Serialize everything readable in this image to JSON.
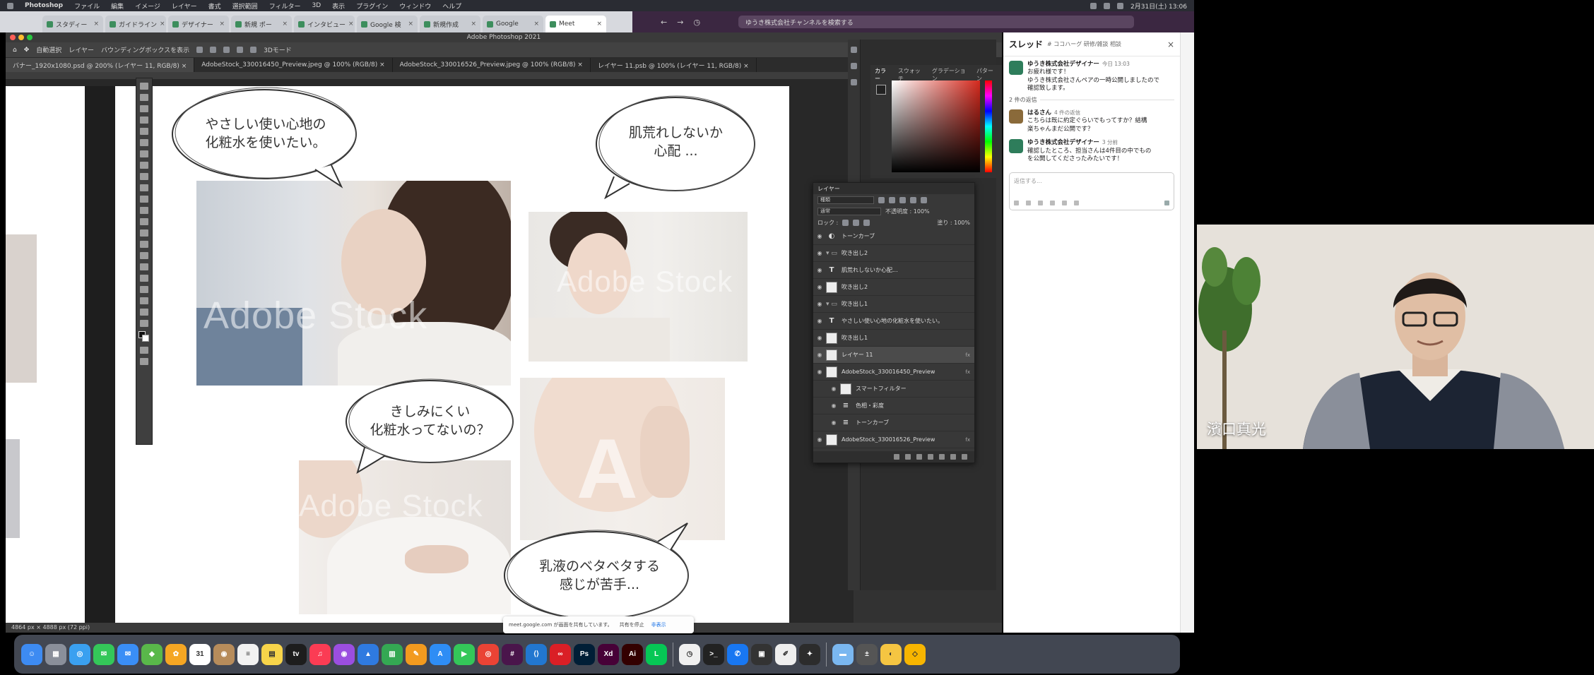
{
  "menubar": {
    "app": "Photoshop",
    "items": [
      "ファイル",
      "編集",
      "イメージ",
      "レイヤー",
      "書式",
      "選択範囲",
      "フィルター",
      "3D",
      "表示",
      "プラグイン",
      "ウィンドウ",
      "ヘルプ"
    ],
    "clock": "2月31日(土) 13:06"
  },
  "browser": {
    "tabs": [
      "スタディー",
      "ガイドライン",
      "デザイナー",
      "新規 ポー",
      "インタビュー",
      "Google 検",
      "新規作成",
      "Google",
      "Meet"
    ],
    "slack_search_placeholder": "ゆうき株式会社チャンネルを検索する"
  },
  "photoshop": {
    "title": "Adobe Photoshop 2021",
    "options": [
      "自動選択",
      "レイヤー",
      "バウンディングボックスを表示",
      "3Dモード"
    ],
    "doc_tabs": [
      "バナー_1920x1080.psd @ 200% (レイヤー 11, RGB/8) ×",
      "AdobeStock_330016450_Preview.jpeg @ 100% (RGB/8) ×",
      "AdobeStock_330016526_Preview.jpeg @ 100% (RGB/8) ×",
      "レイヤー 11.psb @ 100% (レイヤー 11, RGB/8) ×"
    ],
    "status": "4864 px × 4888 px (72 ppi)",
    "watermark": "Adobe Stock",
    "bubbles": [
      "やさしい使い心地の\n化粧水を使いたい。",
      "肌荒れしないか\n心配 ...",
      "きしみにくい\n化粧水ってないの？",
      "乳液のベタベタする\n感じが苦手..."
    ],
    "color_panel": {
      "tabs": [
        "カラー",
        "スウォッチ",
        "グラデーション",
        "パターン"
      ],
      "hue_color": "#d52a1e"
    },
    "layers_panel": {
      "title": "レイヤー",
      "kind": "種類",
      "blend": "通常",
      "opacity": "不透明度 : 100%",
      "fill": "塗り : 100%",
      "lock": "ロック :",
      "layers": [
        {
          "name": "トーンカーブ",
          "type": "adjust",
          "fx": ""
        },
        {
          "name": "吹き出し2",
          "type": "group",
          "fx": ""
        },
        {
          "name": "肌荒れしないか心配...",
          "type": "text",
          "fx": ""
        },
        {
          "name": "吹き出し2",
          "type": "image",
          "fx": ""
        },
        {
          "name": "吹き出し1",
          "type": "group",
          "fx": ""
        },
        {
          "name": "やさしい使い心地の化粧水を使いたい。",
          "type": "text",
          "fx": ""
        },
        {
          "name": "吹き出し1",
          "type": "image",
          "fx": ""
        },
        {
          "name": "レイヤー 11",
          "type": "smart",
          "fx": "fx"
        },
        {
          "name": "AdobeStock_330016450_Preview",
          "type": "smart",
          "fx": "fx"
        },
        {
          "name": "スマートフィルター",
          "type": "filter",
          "fx": ""
        },
        {
          "name": "色相・彩度",
          "type": "effect",
          "fx": ""
        },
        {
          "name": "トーンカーブ",
          "type": "effect",
          "fx": ""
        },
        {
          "name": "AdobeStock_330016526_Preview",
          "type": "smart",
          "fx": "fx"
        }
      ]
    }
  },
  "thread": {
    "title": "スレッド",
    "channel": "# ココハーグ 研修/雑談 相談",
    "close": "×",
    "messages": [
      {
        "name": "ゆうき株式会社デザイナー",
        "time": "今日 13:03",
        "text": "お疲れ様です！\nゆうき株式会社さんペアの一時公開しましたので\n確認致します。",
        "color": "#2e7d5b"
      },
      {
        "name": "はるさん",
        "time": "4 件の返信",
        "text": "こちらは既に約定ぐらいでもってすか？結構\n楽ちゃんまだ公開です？",
        "color": "#8a6a3a"
      },
      {
        "name": "ゆうき株式会社デザイナー",
        "time": "3 分前",
        "text": "確認したところ、担当さんは4件目の中でもの\nを公開してくださったみたいです！",
        "color": "#2e7d5b"
      }
    ],
    "replies_label": "2 件の返信",
    "composer_placeholder": "返信する..."
  },
  "notification": {
    "text": "meet.google.com が画面を共有しています。",
    "stop": "共有を停止",
    "hide": "非表示"
  },
  "dock": {
    "apps": [
      {
        "name": "Finder",
        "color": "#3d8bf2",
        "glyph": "☺"
      },
      {
        "name": "Launchpad",
        "color": "#8a8f9a",
        "glyph": "▦"
      },
      {
        "name": "Safari",
        "color": "#3aa0f0",
        "glyph": "◎"
      },
      {
        "name": "Messages",
        "color": "#34c759",
        "glyph": "✉"
      },
      {
        "name": "Mail",
        "color": "#3a8ef6",
        "glyph": "✉"
      },
      {
        "name": "Maps",
        "color": "#59b84a",
        "glyph": "◆"
      },
      {
        "name": "Photos",
        "color": "#f5a623",
        "glyph": "✿"
      },
      {
        "name": "Calendar",
        "color": "#ffffff",
        "glyph": "31"
      },
      {
        "name": "Contacts",
        "color": "#b78c5b",
        "glyph": "◉"
      },
      {
        "name": "Reminders",
        "color": "#f2f2f2",
        "glyph": "≡"
      },
      {
        "name": "Notes",
        "color": "#f7d44a",
        "glyph": "▤"
      },
      {
        "name": "TV",
        "color": "#1d1d1d",
        "glyph": "tv"
      },
      {
        "name": "Music",
        "color": "#fb3c54",
        "glyph": "♫"
      },
      {
        "name": "Podcasts",
        "color": "#9b4ee0",
        "glyph": "◉"
      },
      {
        "name": "Keynote",
        "color": "#2f7ae0",
        "glyph": "▲"
      },
      {
        "name": "Numbers",
        "color": "#34a853",
        "glyph": "▥"
      },
      {
        "name": "Pages",
        "color": "#f29a1f",
        "glyph": "✎"
      },
      {
        "name": "App Store",
        "color": "#2e8df5",
        "glyph": "A"
      },
      {
        "name": "Facetime",
        "color": "#34c759",
        "glyph": "▶"
      },
      {
        "name": "Chrome",
        "color": "#ea4335",
        "glyph": "◎"
      },
      {
        "name": "Slack",
        "color": "#4a154b",
        "glyph": "#"
      },
      {
        "name": "VS Code",
        "color": "#2277d0",
        "glyph": "⟨⟩"
      },
      {
        "name": "Creative Cloud",
        "color": "#da1f26",
        "glyph": "∞"
      },
      {
        "name": "Photoshop",
        "color": "#001e36",
        "glyph": "Ps"
      },
      {
        "name": "XD",
        "color": "#470137",
        "glyph": "Xd"
      },
      {
        "name": "Illustrator",
        "color": "#330000",
        "glyph": "Ai"
      },
      {
        "name": "LINE",
        "color": "#06c755",
        "glyph": "L"
      },
      {
        "name": "Clock",
        "color": "#f0f0f0",
        "glyph": "◷"
      },
      {
        "name": "Terminal",
        "color": "#222222",
        "glyph": ">_"
      },
      {
        "name": "Messenger",
        "color": "#1877f2",
        "glyph": "✆"
      },
      {
        "name": "Console",
        "color": "#333333",
        "glyph": "▣"
      },
      {
        "name": "TextEdit",
        "color": "#eeeeee",
        "glyph": "✐"
      },
      {
        "name": "Figma",
        "color": "#2c2c2c",
        "glyph": "✦"
      },
      {
        "name": "Folder",
        "color": "#7ab7f0",
        "glyph": "▬"
      },
      {
        "name": "Calculator",
        "color": "#555555",
        "glyph": "±"
      },
      {
        "name": "Cyberduck",
        "color": "#f5c542",
        "glyph": "◐"
      },
      {
        "name": "Sketch",
        "color": "#f7b500",
        "glyph": "◇"
      }
    ]
  },
  "webcam": {
    "participant_name": "濱口真光"
  }
}
